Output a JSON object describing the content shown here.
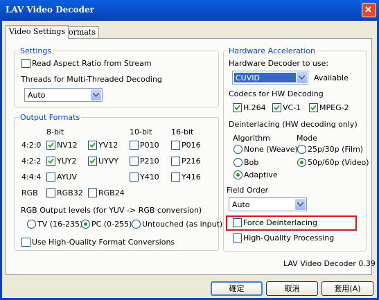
{
  "window": {
    "title": "LAV Video Decoder"
  },
  "tabs": [
    {
      "label": "Video Settings"
    },
    {
      "label": "Formats"
    }
  ],
  "settings": {
    "group_label": "Settings",
    "aspect_ratio_label": "Read Aspect Ratio from Stream",
    "aspect_ratio_checked": false,
    "threads_label": "Threads for Multi-Threaded Decoding",
    "threads_value": "Auto"
  },
  "output_formats": {
    "group_label": "Output Formats",
    "col_8bit": "8-bit",
    "col_10bit": "10-bit",
    "col_16bit": "16-bit",
    "row_420": "4:2:0",
    "row_422": "4:2:2",
    "row_444": "4:4:4",
    "row_rgb": "RGB",
    "nv12": {
      "label": "NV12",
      "checked": true
    },
    "yv12": {
      "label": "YV12",
      "checked": true
    },
    "p010": {
      "label": "P010",
      "checked": false
    },
    "p016": {
      "label": "P016",
      "checked": false
    },
    "yuy2": {
      "label": "YUY2",
      "checked": true
    },
    "uyvy": {
      "label": "UYVY",
      "checked": true
    },
    "p210": {
      "label": "P210",
      "checked": false
    },
    "p216": {
      "label": "P216",
      "checked": false
    },
    "ayuv": {
      "label": "AYUV",
      "checked": false
    },
    "y410": {
      "label": "Y410",
      "checked": false
    },
    "y416": {
      "label": "Y416",
      "checked": false
    },
    "rgb32": {
      "label": "RGB32",
      "checked": false
    },
    "rgb24": {
      "label": "RGB24",
      "checked": false
    },
    "rgb_levels_label": "RGB Output levels (for YUV -> RGB conversion)",
    "level_tv": "TV (16-235)",
    "level_pc": "PC (0-255)",
    "level_untouched": "Untouched (as input)",
    "level_selected": "PC (0-255)",
    "hq_conversion_label": "Use High-Quality Format Conversions",
    "hq_conversion_checked": false
  },
  "hw_accel": {
    "group_label": "Hardware Acceleration",
    "decoder_label": "Hardware Decoder to use:",
    "decoder_value": "CUVID",
    "decoder_status": "Available",
    "codecs_label": "Codecs for HW Decoding",
    "h264": {
      "label": "H.264",
      "checked": true
    },
    "vc1": {
      "label": "VC-1",
      "checked": true
    },
    "mpeg2": {
      "label": "MPEG-2",
      "checked": true
    },
    "deint_label": "Deinterlacing (HW decoding only)",
    "algorithm_label": "Algorithm",
    "mode_label": "Mode",
    "algo_none": "None (Weave)",
    "algo_bob": "Bob",
    "algo_adaptive": "Adaptive",
    "algo_selected": "Adaptive",
    "mode_film": "25p/30p (Film)",
    "mode_video": "50p/60p (Video)",
    "mode_selected": "50p/60p (Video)",
    "field_order_label": "Field Order",
    "field_order_value": "Auto",
    "force_deint_label": "Force Deinterlacing",
    "force_deint_checked": false,
    "hq_processing_label": "High-Quality Processing",
    "hq_processing_checked": false
  },
  "version_text": "LAV Video Decoder 0.39",
  "buttons": {
    "ok": "確定",
    "cancel": "取消",
    "apply": "套用(A)"
  },
  "colors": {
    "title_bar": "#0a4fd0",
    "group_label": "#0046d5",
    "highlight": "#e0141c",
    "check": "#21a121"
  }
}
